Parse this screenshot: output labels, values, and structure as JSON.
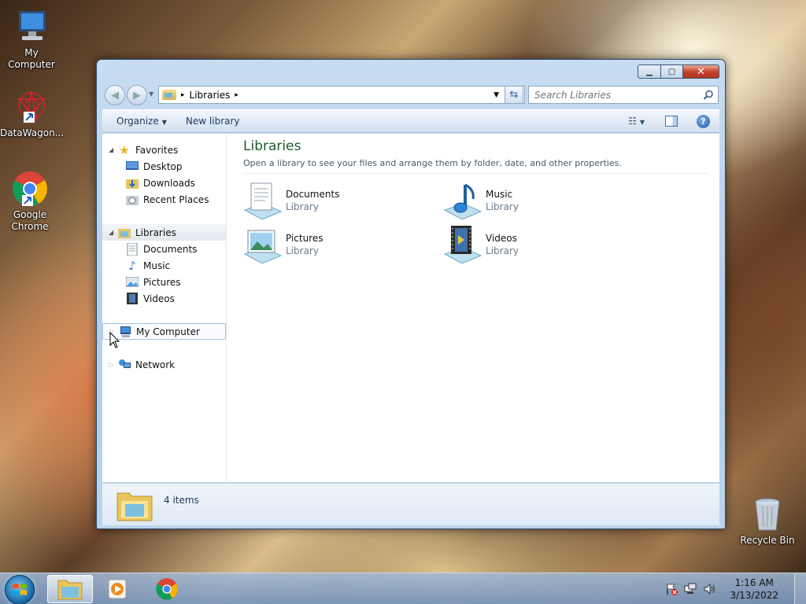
{
  "desktop": {
    "icons": [
      {
        "label": "My Computer"
      },
      {
        "label": "DataWagon..."
      },
      {
        "label": "Google Chrome"
      },
      {
        "label": "Recycle Bin"
      }
    ]
  },
  "window": {
    "address": {
      "crumb": "Libraries",
      "sep": "▸"
    },
    "search": {
      "placeholder": "Search Libraries"
    },
    "toolbar": {
      "organize": "Organize",
      "new_library": "New library"
    },
    "nav": {
      "favorites": "Favorites",
      "desktop": "Desktop",
      "downloads": "Downloads",
      "recent": "Recent Places",
      "libraries": "Libraries",
      "documents": "Documents",
      "music": "Music",
      "pictures": "Pictures",
      "videos": "Videos",
      "computer": "My Computer",
      "network": "Network"
    },
    "content": {
      "title": "Libraries",
      "subtitle": "Open a library to see your files and arrange them by folder, date, and other properties.",
      "items": [
        {
          "name": "Documents",
          "type": "Library"
        },
        {
          "name": "Music",
          "type": "Library"
        },
        {
          "name": "Pictures",
          "type": "Library"
        },
        {
          "name": "Videos",
          "type": "Library"
        }
      ]
    },
    "details": {
      "count": "4 items"
    }
  },
  "taskbar": {
    "clock": {
      "time": "1:16 AM",
      "date": "3/13/2022"
    }
  },
  "colors": {
    "title_green": "#1e5d2a",
    "link_blue": "#1e395b"
  }
}
